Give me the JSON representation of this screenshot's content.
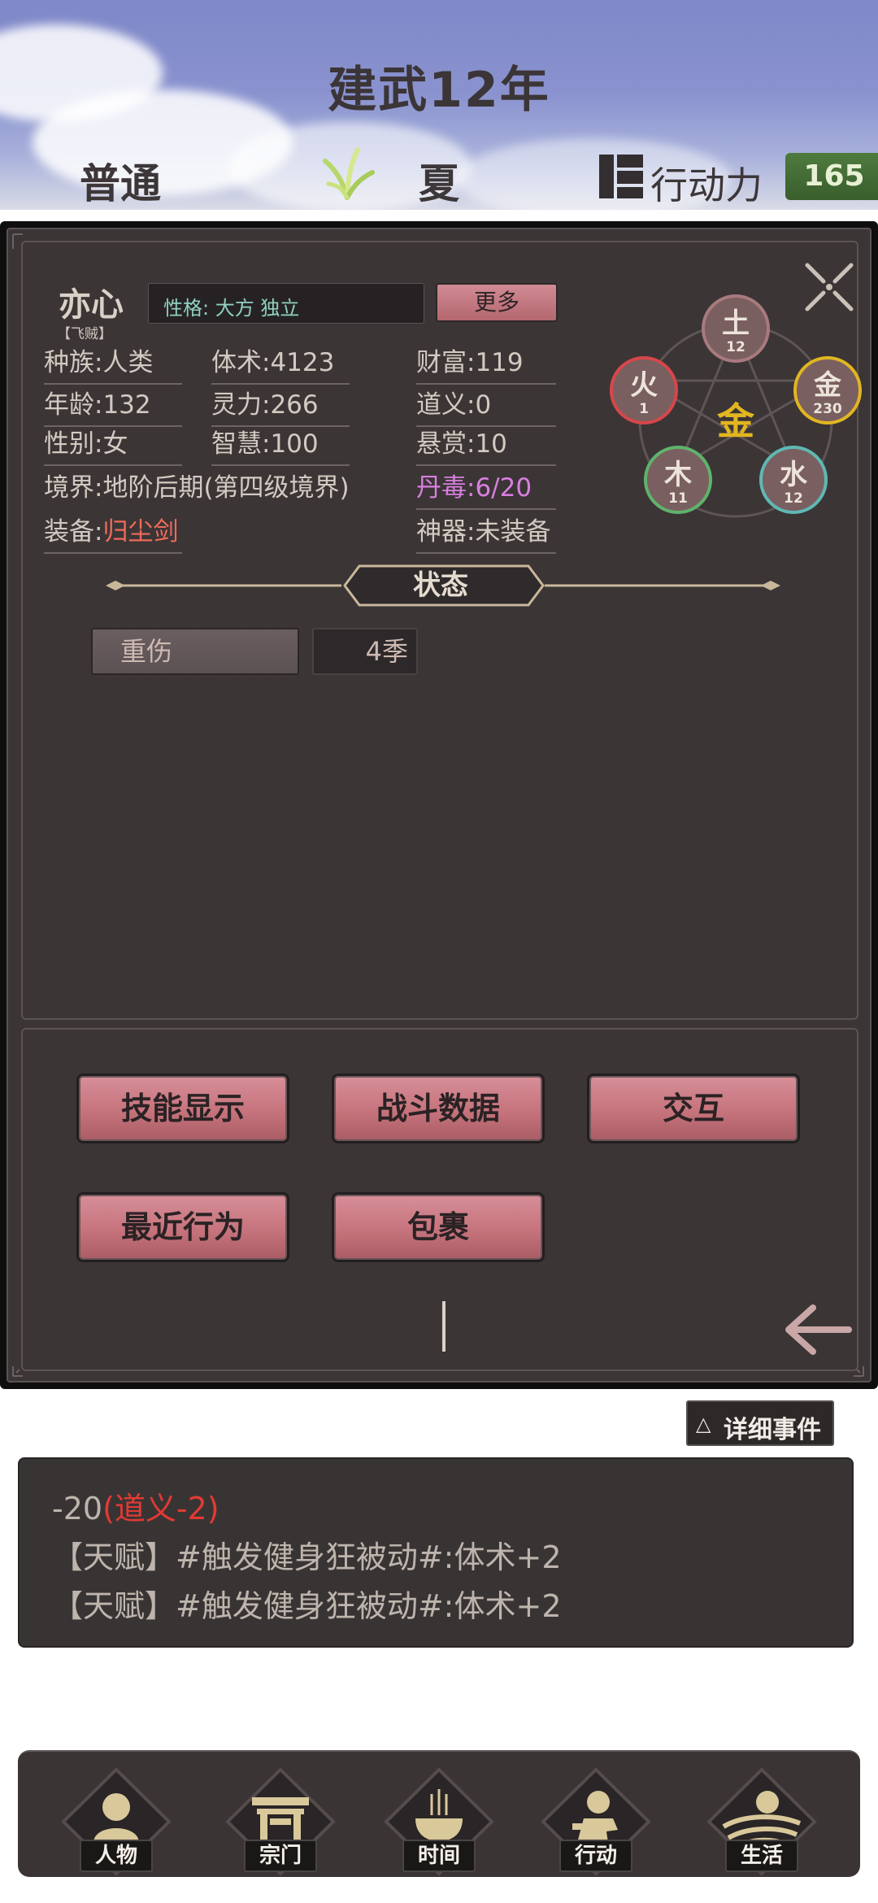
{
  "header": {
    "year": "建武12年",
    "difficulty": "普通",
    "season": "夏",
    "season_icon": "grass-sprout-icon",
    "action_points_label": "行动力",
    "action_points_value": "165"
  },
  "character": {
    "name": "亦心",
    "title": "【飞贼】",
    "personality": "性格: 大方 独立",
    "more_label": "更多",
    "stats": {
      "race": "种族:人类",
      "age": "年龄:132",
      "gender": "性别:女",
      "realm": "境界:地阶后期(第四级境界)",
      "equip_label": "装备:",
      "equip_value": "归尘剑",
      "body": "体术:4123",
      "spirit": "灵力:266",
      "wisdom": "智慧:100",
      "wealth": "财富:119",
      "morality": "道义:0",
      "bounty": "悬赏:10",
      "poison": "丹毒:6/20",
      "artifact": "神器:未装备"
    }
  },
  "wuxing": {
    "center": "金",
    "earth": {
      "label": "土",
      "value": "12"
    },
    "fire": {
      "label": "火",
      "value": "1"
    },
    "metal": {
      "label": "金",
      "value": "230"
    },
    "wood": {
      "label": "木",
      "value": "11"
    },
    "water": {
      "label": "水",
      "value": "12"
    }
  },
  "status": {
    "title": "状态",
    "effect_name": "重伤",
    "effect_duration": "4季"
  },
  "actions": {
    "skills": "技能显示",
    "combat": "战斗数据",
    "interact": "交互",
    "recent": "最近行为",
    "bag": "包裹"
  },
  "events": {
    "detail_label": "详细事件",
    "line1_prefix": "-20",
    "line1_red": "(道义-2)",
    "line2": "【天赋】#触发健身狂被动#:体术+2",
    "line3": "【天赋】#触发健身狂被动#:体术+2"
  },
  "nav": {
    "character": "人物",
    "sect": "宗门",
    "time": "时间",
    "action": "行动",
    "life": "生活"
  },
  "colors": {
    "panel_bg": "#3b3536",
    "button_pink": "#c6737c",
    "accent_green": "#4f7b3f",
    "event_red": "#e23a34"
  }
}
